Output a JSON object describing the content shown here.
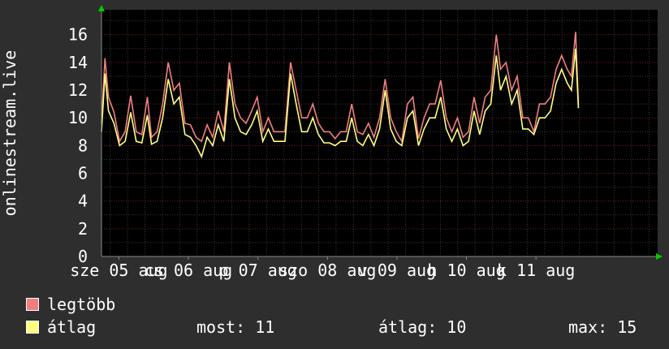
{
  "chart_data": {
    "type": "line",
    "ylabel": "onlinestream.live",
    "yticks": [
      0,
      2,
      4,
      6,
      8,
      10,
      12,
      14,
      16
    ],
    "ylim": [
      0,
      17.8
    ],
    "xticks": [
      {
        "label": "sze 05 aug",
        "day": 4.25
      },
      {
        "label": "cs 06 aug",
        "day": 5.25
      },
      {
        "label": "p 07 aug",
        "day": 6.25
      },
      {
        "label": "szo 08 aug",
        "day": 7.25
      },
      {
        "label": "v 09 aug",
        "day": 8.25
      },
      {
        "label": "h 10 aug",
        "day": 9.25
      },
      {
        "label": "k 11 aug",
        "day": 10.25
      }
    ],
    "xlim": [
      4.0,
      12.0
    ],
    "grid": true,
    "series": [
      {
        "name": "legtöbb",
        "color": "#f07e80",
        "points": [
          [
            4.0,
            9.6
          ],
          [
            4.05,
            14.3
          ],
          [
            4.1,
            11.5
          ],
          [
            4.18,
            10.4
          ],
          [
            4.26,
            8.3
          ],
          [
            4.34,
            9.0
          ],
          [
            4.42,
            11.6
          ],
          [
            4.5,
            9.0
          ],
          [
            4.58,
            8.8
          ],
          [
            4.66,
            11.5
          ],
          [
            4.72,
            8.6
          ],
          [
            4.8,
            9.0
          ],
          [
            4.88,
            11.0
          ],
          [
            4.96,
            14.0
          ],
          [
            5.04,
            12.0
          ],
          [
            5.12,
            12.5
          ],
          [
            5.2,
            9.6
          ],
          [
            5.28,
            9.5
          ],
          [
            5.36,
            8.6
          ],
          [
            5.44,
            8.3
          ],
          [
            5.52,
            9.5
          ],
          [
            5.6,
            8.6
          ],
          [
            5.68,
            10.5
          ],
          [
            5.76,
            9.0
          ],
          [
            5.84,
            14.0
          ],
          [
            5.92,
            11.0
          ],
          [
            6.0,
            10.0
          ],
          [
            6.08,
            9.6
          ],
          [
            6.16,
            10.5
          ],
          [
            6.24,
            11.5
          ],
          [
            6.32,
            9.0
          ],
          [
            6.4,
            10.0
          ],
          [
            6.48,
            9.0
          ],
          [
            6.56,
            9.0
          ],
          [
            6.64,
            9.0
          ],
          [
            6.72,
            14.0
          ],
          [
            6.8,
            12.0
          ],
          [
            6.88,
            10.0
          ],
          [
            6.96,
            10.0
          ],
          [
            7.04,
            11.0
          ],
          [
            7.12,
            9.6
          ],
          [
            7.2,
            9.0
          ],
          [
            7.28,
            9.0
          ],
          [
            7.36,
            8.5
          ],
          [
            7.44,
            9.0
          ],
          [
            7.52,
            9.0
          ],
          [
            7.6,
            11.0
          ],
          [
            7.68,
            9.0
          ],
          [
            7.76,
            8.8
          ],
          [
            7.84,
            9.6
          ],
          [
            7.92,
            8.6
          ],
          [
            8.0,
            10.0
          ],
          [
            8.08,
            12.8
          ],
          [
            8.16,
            10.0
          ],
          [
            8.24,
            9.0
          ],
          [
            8.32,
            8.3
          ],
          [
            8.4,
            11.0
          ],
          [
            8.48,
            11.5
          ],
          [
            8.56,
            8.5
          ],
          [
            8.64,
            10.0
          ],
          [
            8.72,
            11.0
          ],
          [
            8.8,
            11.0
          ],
          [
            8.88,
            12.7
          ],
          [
            8.96,
            10.0
          ],
          [
            9.04,
            9.0
          ],
          [
            9.12,
            10.0
          ],
          [
            9.2,
            8.6
          ],
          [
            9.28,
            9.0
          ],
          [
            9.36,
            11.5
          ],
          [
            9.44,
            9.6
          ],
          [
            9.52,
            11.5
          ],
          [
            9.6,
            12.0
          ],
          [
            9.68,
            16.0
          ],
          [
            9.74,
            13.5
          ],
          [
            9.82,
            14.0
          ],
          [
            9.9,
            12.0
          ],
          [
            9.98,
            13.0
          ],
          [
            10.06,
            10.0
          ],
          [
            10.14,
            10.0
          ],
          [
            10.22,
            9.0
          ],
          [
            10.3,
            11.0
          ],
          [
            10.38,
            11.0
          ],
          [
            10.46,
            11.5
          ],
          [
            10.54,
            13.5
          ],
          [
            10.62,
            14.5
          ],
          [
            10.7,
            13.5
          ],
          [
            10.76,
            13.0
          ],
          [
            10.82,
            16.2
          ],
          [
            10.86,
            11.0
          ]
        ]
      },
      {
        "name": "átlag",
        "color": "#ffff80",
        "points": [
          [
            4.0,
            9.0
          ],
          [
            4.05,
            13.2
          ],
          [
            4.1,
            10.5
          ],
          [
            4.18,
            9.6
          ],
          [
            4.26,
            8.0
          ],
          [
            4.34,
            8.3
          ],
          [
            4.42,
            10.4
          ],
          [
            4.5,
            8.3
          ],
          [
            4.58,
            8.2
          ],
          [
            4.66,
            10.2
          ],
          [
            4.72,
            8.1
          ],
          [
            4.8,
            8.3
          ],
          [
            4.88,
            10.0
          ],
          [
            4.96,
            12.8
          ],
          [
            5.04,
            11.0
          ],
          [
            5.12,
            11.5
          ],
          [
            5.2,
            8.8
          ],
          [
            5.28,
            8.6
          ],
          [
            5.36,
            8.0
          ],
          [
            5.44,
            7.2
          ],
          [
            5.52,
            8.6
          ],
          [
            5.6,
            8.0
          ],
          [
            5.68,
            9.5
          ],
          [
            5.76,
            8.3
          ],
          [
            5.84,
            12.8
          ],
          [
            5.92,
            10.0
          ],
          [
            6.0,
            9.0
          ],
          [
            6.08,
            8.8
          ],
          [
            6.16,
            9.5
          ],
          [
            6.24,
            10.5
          ],
          [
            6.32,
            8.3
          ],
          [
            6.4,
            9.2
          ],
          [
            6.48,
            8.3
          ],
          [
            6.56,
            8.3
          ],
          [
            6.64,
            8.3
          ],
          [
            6.72,
            13.2
          ],
          [
            6.8,
            11.0
          ],
          [
            6.88,
            9.0
          ],
          [
            6.96,
            9.0
          ],
          [
            7.04,
            10.0
          ],
          [
            7.12,
            8.8
          ],
          [
            7.2,
            8.2
          ],
          [
            7.28,
            8.2
          ],
          [
            7.36,
            8.0
          ],
          [
            7.44,
            8.3
          ],
          [
            7.52,
            8.3
          ],
          [
            7.6,
            10.0
          ],
          [
            7.68,
            8.3
          ],
          [
            7.76,
            8.0
          ],
          [
            7.84,
            8.8
          ],
          [
            7.92,
            8.0
          ],
          [
            8.0,
            9.2
          ],
          [
            8.08,
            12.0
          ],
          [
            8.16,
            9.2
          ],
          [
            8.24,
            8.3
          ],
          [
            8.32,
            8.0
          ],
          [
            8.4,
            10.0
          ],
          [
            8.48,
            10.5
          ],
          [
            8.56,
            8.0
          ],
          [
            8.64,
            9.2
          ],
          [
            8.72,
            10.0
          ],
          [
            8.8,
            10.0
          ],
          [
            8.88,
            11.5
          ],
          [
            8.96,
            9.2
          ],
          [
            9.04,
            8.3
          ],
          [
            9.12,
            9.2
          ],
          [
            9.2,
            8.0
          ],
          [
            9.28,
            8.3
          ],
          [
            9.36,
            10.5
          ],
          [
            9.44,
            8.8
          ],
          [
            9.52,
            10.5
          ],
          [
            9.6,
            11.0
          ],
          [
            9.68,
            14.5
          ],
          [
            9.74,
            12.0
          ],
          [
            9.82,
            13.0
          ],
          [
            9.9,
            11.0
          ],
          [
            9.98,
            12.0
          ],
          [
            10.06,
            9.2
          ],
          [
            10.14,
            9.2
          ],
          [
            10.22,
            8.8
          ],
          [
            10.3,
            10.0
          ],
          [
            10.38,
            10.0
          ],
          [
            10.46,
            10.5
          ],
          [
            10.54,
            12.5
          ],
          [
            10.62,
            13.5
          ],
          [
            10.7,
            12.5
          ],
          [
            10.76,
            12.0
          ],
          [
            10.82,
            15.0
          ],
          [
            10.86,
            10.7
          ]
        ]
      }
    ]
  },
  "legend": {
    "max_label": "legtöbb",
    "avg_label": "átlag",
    "now_text": "most: 11",
    "avg_text": "átlag: 10",
    "max_text": "max: 15"
  }
}
